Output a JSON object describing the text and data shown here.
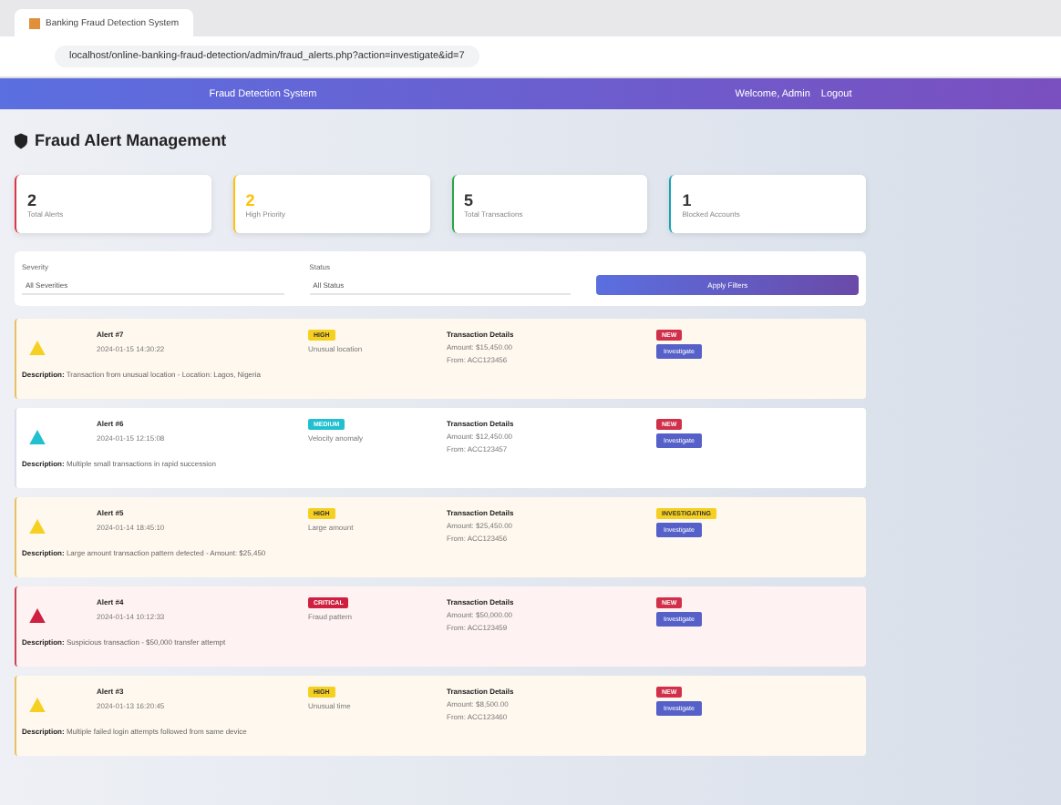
{
  "browser": {
    "tab_title": "Banking Fraud Detection System",
    "url": "localhost/online-banking-fraud-detection/admin/fraud_alerts.php?action=investigate&id=7"
  },
  "navbar": {
    "brand": "Fraud Detection System",
    "user": "Welcome, Admin",
    "logout": "Logout"
  },
  "page_title": "Fraud Alert Management",
  "stats": [
    {
      "value": "2",
      "label": "Total Alerts",
      "color": "#dc3545"
    },
    {
      "value": "2",
      "label": "High Priority",
      "color": "#ffc107"
    },
    {
      "value": "5",
      "label": "Total Transactions",
      "color": "#28a745"
    },
    {
      "value": "1",
      "label": "Blocked Accounts",
      "color": "#17a2b8"
    }
  ],
  "filters": {
    "severity_label": "Severity",
    "severity_value": "All Severities",
    "status_label": "Status",
    "status_value": "All Status",
    "button": "Apply Filters"
  },
  "alerts": [
    {
      "kind": "medium",
      "title": "Alert #7",
      "date": "2024-01-15 14:30:22",
      "badge": "HIGH",
      "type": "Unusual location",
      "details_title": "Transaction Details",
      "amount": "Amount: $15,450.00",
      "from": "From: ACC123456",
      "status": {
        "label": "NEW",
        "color": "#d0304a"
      },
      "action": "Investigate",
      "desc_label": "Description:",
      "description": "Transaction from unusual location - Location: Lagos, Nigeria"
    },
    {
      "kind": "low",
      "title": "Alert #6",
      "date": "2024-01-15 12:15:08",
      "badge": "MEDIUM",
      "type": "Velocity anomaly",
      "details_title": "Transaction Details",
      "amount": "Amount: $12,450.00",
      "from": "From: ACC123457",
      "status": {
        "label": "NEW",
        "color": "#d0304a"
      },
      "action": "Investigate",
      "desc_label": "Description:",
      "description": "Multiple small transactions in rapid succession"
    },
    {
      "kind": "medium",
      "title": "Alert #5",
      "date": "2024-01-14 18:45:10",
      "badge": "HIGH",
      "type": "Large amount",
      "details_title": "Transaction Details",
      "amount": "Amount: $25,450.00",
      "from": "From: ACC123456",
      "status": {
        "label": "INVESTIGATING",
        "color": "#f5d020"
      },
      "action": "Investigate",
      "desc_label": "Description:",
      "description": "Large amount transaction pattern detected - Amount: $25,450"
    },
    {
      "kind": "high",
      "title": "Alert #4",
      "date": "2024-01-14 10:12:33",
      "badge": "CRITICAL",
      "type": "Fraud pattern",
      "details_title": "Transaction Details",
      "amount": "Amount: $50,000.00",
      "from": "From: ACC123459",
      "status": {
        "label": "NEW",
        "color": "#d0304a"
      },
      "action": "Investigate",
      "desc_label": "Description:",
      "description": "Suspicious transaction - $50,000 transfer attempt"
    },
    {
      "kind": "medium",
      "title": "Alert #3",
      "date": "2024-01-13 16:20:45",
      "badge": "HIGH",
      "type": "Unusual time",
      "details_title": "Transaction Details",
      "amount": "Amount: $8,500.00",
      "from": "From: ACC123460",
      "status": {
        "label": "NEW",
        "color": "#d0304a"
      },
      "action": "Investigate",
      "desc_label": "Description:",
      "description": "Multiple failed login attempts followed from same device"
    }
  ]
}
